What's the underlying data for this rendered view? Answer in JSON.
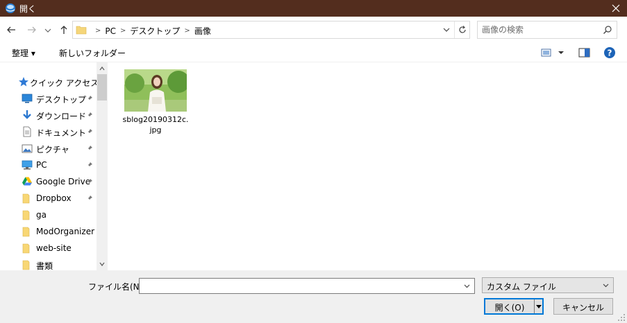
{
  "window": {
    "title": "開く",
    "icons": {
      "app": "globe-app-icon",
      "close": "close-icon"
    }
  },
  "address_bar": {
    "breadcrumbs": [
      "PC",
      "デスクトップ",
      "画像"
    ],
    "icons": [
      "back-arrow-icon",
      "forward-arrow-icon",
      "recent-dropdown-icon",
      "up-arrow-icon",
      "folder-icon",
      "chevron-down-icon",
      "refresh-icon"
    ]
  },
  "search": {
    "placeholder": "画像の検索",
    "icon": "search-icon"
  },
  "toolbar": {
    "organize_label": "整理 ▾",
    "new_folder_label": "新しいフォルダー",
    "icons": [
      "view-options-icon",
      "preview-pane-icon",
      "help-icon"
    ]
  },
  "nav": {
    "quick_access": {
      "label": "クイック アクセス",
      "icon": "star-icon"
    },
    "items": [
      {
        "label": "デスクトップ",
        "icon": "desktop-icon",
        "pinned": true
      },
      {
        "label": "ダウンロード",
        "icon": "download-icon",
        "pinned": true
      },
      {
        "label": "ドキュメント",
        "icon": "document-icon",
        "pinned": true
      },
      {
        "label": "ピクチャ",
        "icon": "pictures-icon",
        "pinned": true
      },
      {
        "label": "PC",
        "icon": "pc-icon",
        "pinned": true
      },
      {
        "label": "Google Drive",
        "icon": "google-drive-icon",
        "pinned": true
      },
      {
        "label": "Dropbox",
        "icon": "folder-icon",
        "pinned": true
      },
      {
        "label": "ga",
        "icon": "folder-icon",
        "pinned": false
      },
      {
        "label": "ModOrganizer",
        "icon": "folder-icon",
        "pinned": false
      },
      {
        "label": "web-site",
        "icon": "folder-icon",
        "pinned": false
      },
      {
        "label": "書類",
        "icon": "folder-icon",
        "pinned": false
      }
    ]
  },
  "files": [
    {
      "name": "sblog20190312c.jpg",
      "type": "image"
    }
  ],
  "bottom": {
    "filename_label": "ファイル名(N):",
    "filename_value": "",
    "filter_value": "カスタム ファイル",
    "open_label": "開く(O)",
    "cancel_label": "キャンセル"
  },
  "colors": {
    "titlebar": "#532d1e",
    "accent": "#0078d7",
    "bottom_panel": "#f0f0f0"
  }
}
